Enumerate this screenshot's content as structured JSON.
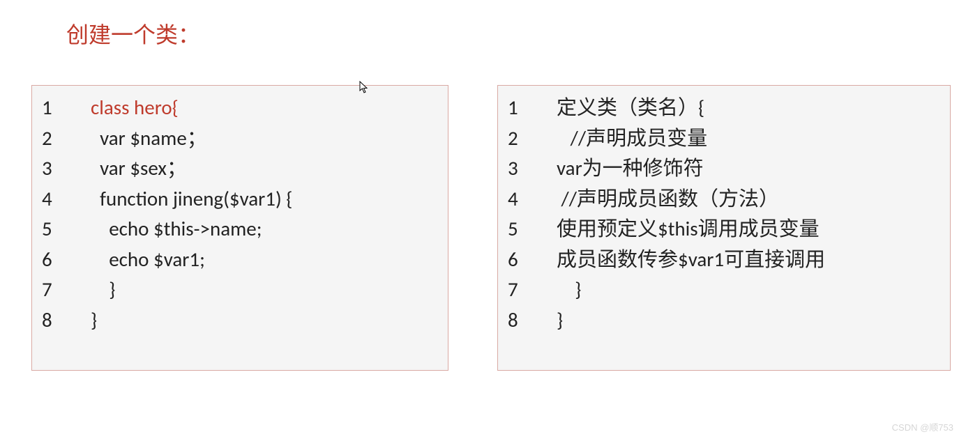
{
  "title": "创建一个类：",
  "left_box": {
    "lines": [
      {
        "num": "1",
        "text": "class hero{",
        "highlight": true
      },
      {
        "num": "2",
        "text": "  var $name；"
      },
      {
        "num": "3",
        "text": "  var $sex；"
      },
      {
        "num": "4",
        "text": "  function jineng($var1) {"
      },
      {
        "num": "5",
        "text": "    echo $this->name;"
      },
      {
        "num": "6",
        "text": "    echo $var1;"
      },
      {
        "num": "7",
        "text": "    }"
      },
      {
        "num": "8",
        "text": "}"
      }
    ]
  },
  "right_box": {
    "lines": [
      {
        "num": "1",
        "text": "定义类（类名）{"
      },
      {
        "num": "2",
        "text": "   //声明成员变量"
      },
      {
        "num": "3",
        "text": "var为一种修饰符"
      },
      {
        "num": "4",
        "text": " //声明成员函数（方法）"
      },
      {
        "num": "5",
        "text": "使用预定义$this调用成员变量"
      },
      {
        "num": "6",
        "text": "成员函数传参$var1可直接调用"
      },
      {
        "num": "7",
        "text": "    }"
      },
      {
        "num": "8",
        "text": "}"
      }
    ]
  },
  "watermark": "CSDN @顺753"
}
